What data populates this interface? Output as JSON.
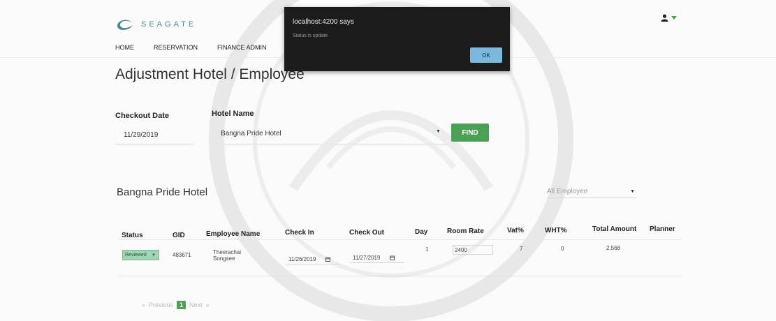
{
  "brand": {
    "name": "SEAGATE"
  },
  "nav": {
    "items": [
      "HOME",
      "RESERVATION",
      "FINANCE ADMIN"
    ]
  },
  "page": {
    "title": "Adjustment Hotel / Employee"
  },
  "filters": {
    "checkout_label": "Checkout Date",
    "checkout_value": "11/29/2019",
    "hotel_label": "Hotel Name",
    "hotel_value": "Bangna Pride Hotel",
    "find_label": "FIND"
  },
  "section": {
    "title": "Bangna Pride Hotel",
    "employee_filter": "All Employee"
  },
  "table": {
    "headers": {
      "status": "Status",
      "gid": "GID",
      "name": "Employee Name",
      "checkin": "Check In",
      "checkout": "Check Out",
      "day": "Day",
      "rate": "Room Rate",
      "vat": "Vat%",
      "wht": "WHT%",
      "total": "Total Amount",
      "planner": "Planner"
    },
    "rows": [
      {
        "status": "Reviewed",
        "gid": "483671",
        "name": "Theerachai Songsee",
        "checkin": "11/26/2019",
        "checkout": "11/27/2019",
        "day": "1",
        "rate": "2400",
        "vat": "7",
        "wht": "0",
        "total": "2,568",
        "planner": ""
      }
    ]
  },
  "pagination": {
    "previous": "Previous",
    "current": "1",
    "next": "Next"
  },
  "dialog": {
    "title": "localhost:4200 says",
    "message": "Status is update",
    "ok_label": "OK"
  },
  "colors": {
    "brand_teal": "#4a8c8a",
    "find_green": "#4aa054",
    "status_green": "#9fd4b4",
    "dialog_bg": "#1b1b1b",
    "ok_blue": "#7ab9dd"
  }
}
